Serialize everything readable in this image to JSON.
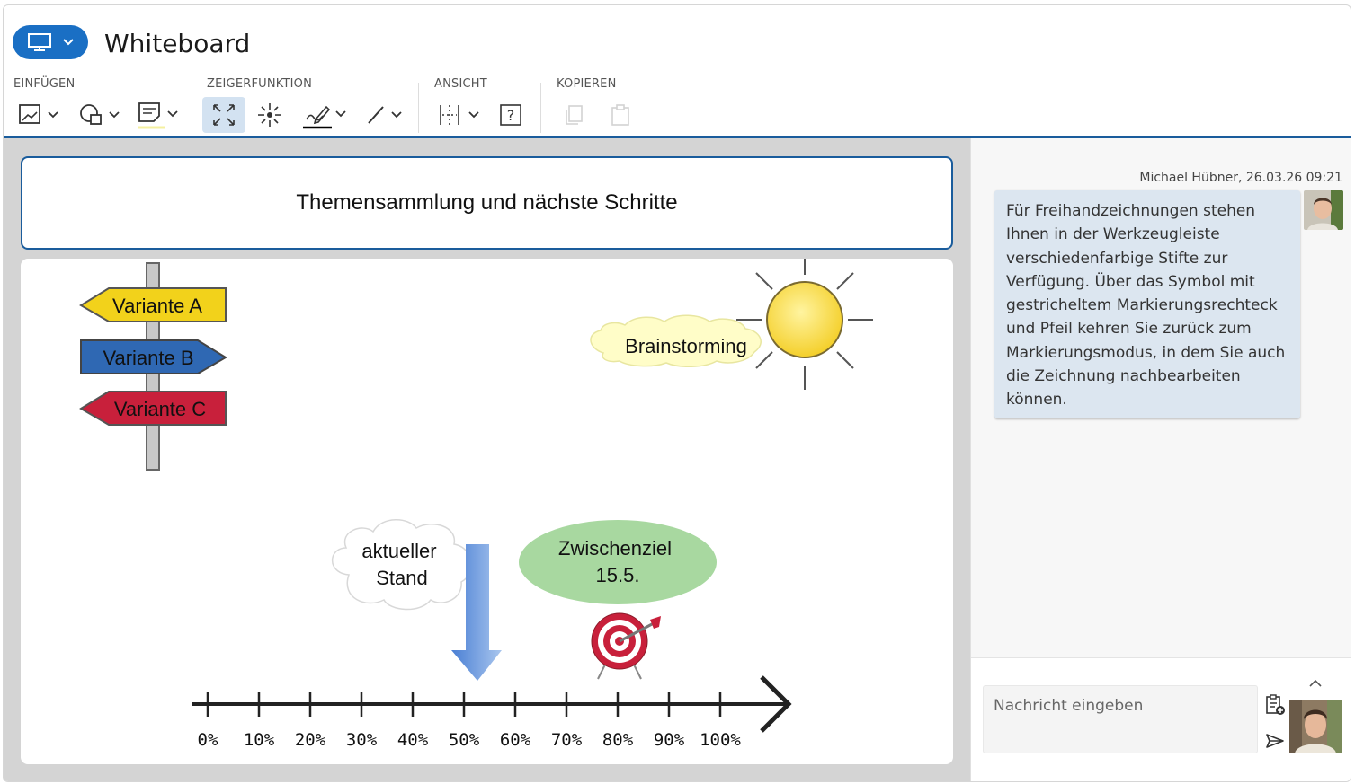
{
  "app": {
    "title": "Whiteboard"
  },
  "toolbar": {
    "groups": {
      "insert": "EINFÜGEN",
      "pointer": "ZEIGERFUNKTION",
      "view": "ANSICHT",
      "copy": "KOPIEREN"
    }
  },
  "board": {
    "title": "Themensammlung und nächste Schritte",
    "signs": [
      "Variante A",
      "Variante B",
      "Variante C"
    ],
    "brainstorm": "Brainstorming",
    "cloud": [
      "aktueller",
      "Stand"
    ],
    "milestone": [
      "Zwischenziel",
      "15.5."
    ],
    "ticks": [
      "0%",
      "10%",
      "20%",
      "30%",
      "40%",
      "50%",
      "60%",
      "70%",
      "80%",
      "90%",
      "100%"
    ]
  },
  "chat": {
    "meta": "Michael Hübner, 26.03.26 09:21",
    "message": "Für Freihandzeichnungen stehen Ihnen in der Werkzeugleiste verschiedenfarbige Stifte zur Verfügung. Über das Symbol mit gestricheltem Markierungsrechteck und Pfeil kehren Sie zurück zum Markierungsmodus, in dem Sie auch die Zeichnung nachbearbeiten können.",
    "input_placeholder": "Nachricht eingeben"
  },
  "colors": {
    "accent": "#1a6fc4",
    "border": "#1a5c9c",
    "sign_a": "#f2d21b",
    "sign_b": "#2f68b3",
    "sign_c": "#c8203b",
    "sun": "#f6d63a",
    "milestone": "#a8d8a0",
    "bubble": "#dce6f0"
  }
}
